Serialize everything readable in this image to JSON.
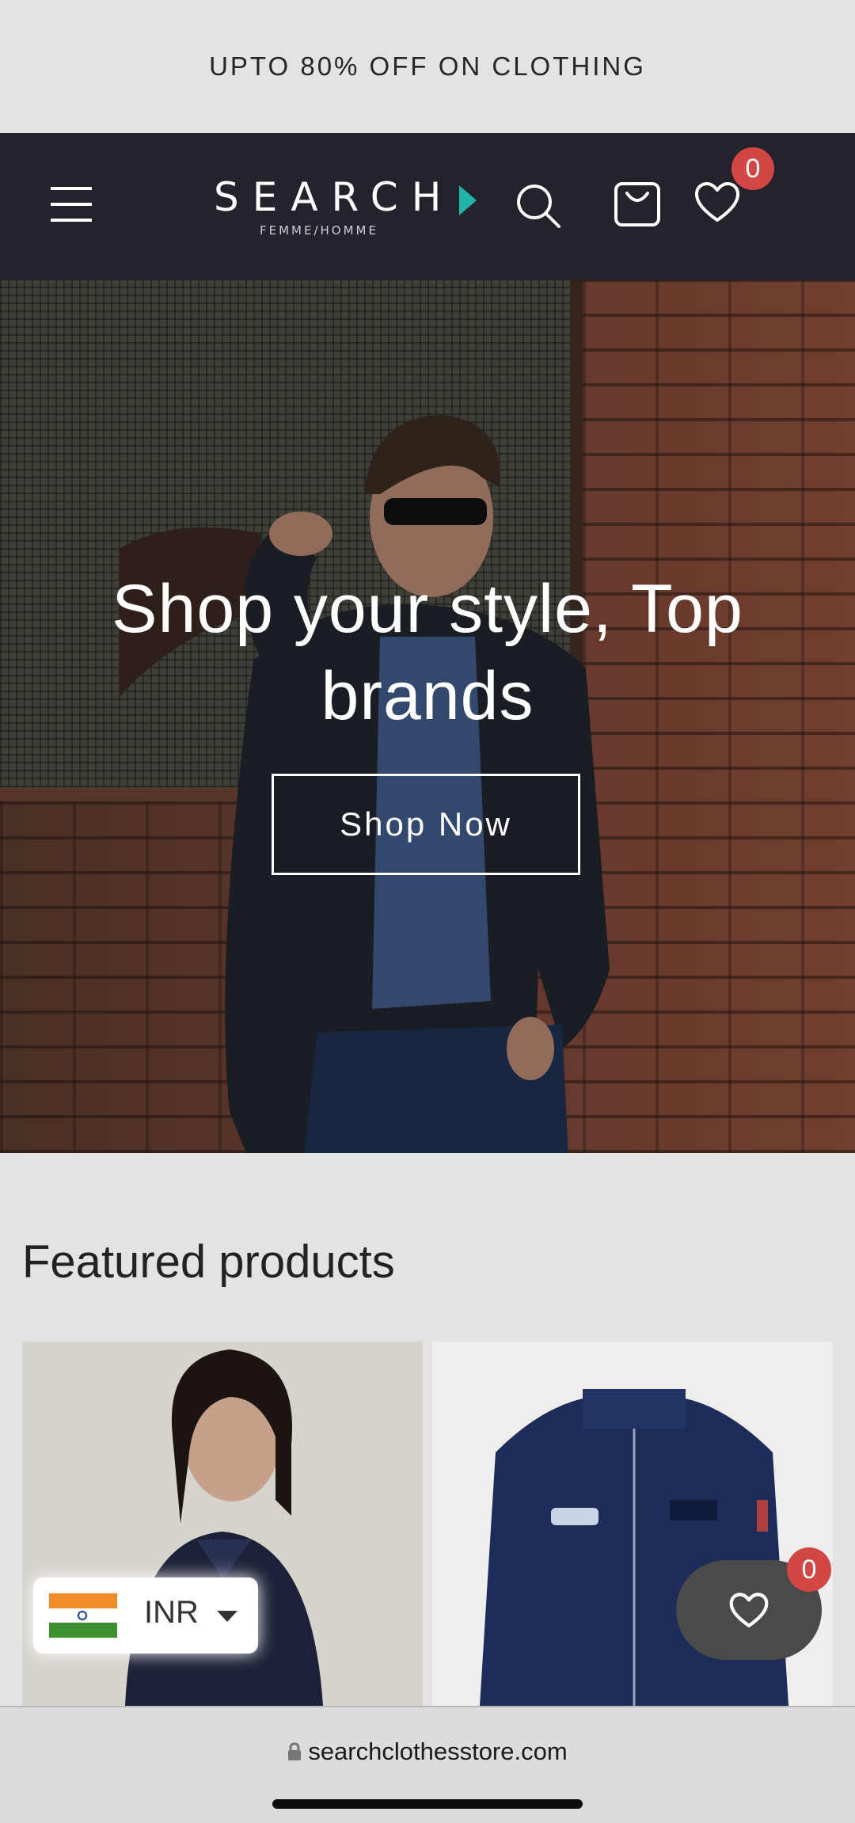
{
  "announcement": "UPTO 80% OFF ON CLOTHING",
  "header": {
    "logo_text": "SEARCH",
    "logo_subtext": "FEMME/HOMME",
    "wishlist_count": "0"
  },
  "hero": {
    "title": "Shop your style, Top brands",
    "cta": "Shop Now"
  },
  "featured": {
    "title": "Featured products"
  },
  "currency": {
    "code": "INR"
  },
  "floating_wishlist": {
    "count": "0"
  },
  "browser": {
    "url": "searchclothesstore.com"
  },
  "colors": {
    "header_bg": "#24222a",
    "badge": "#d24646",
    "logo_accent": "#20b3a8",
    "page_bg": "#e3e3e5"
  }
}
